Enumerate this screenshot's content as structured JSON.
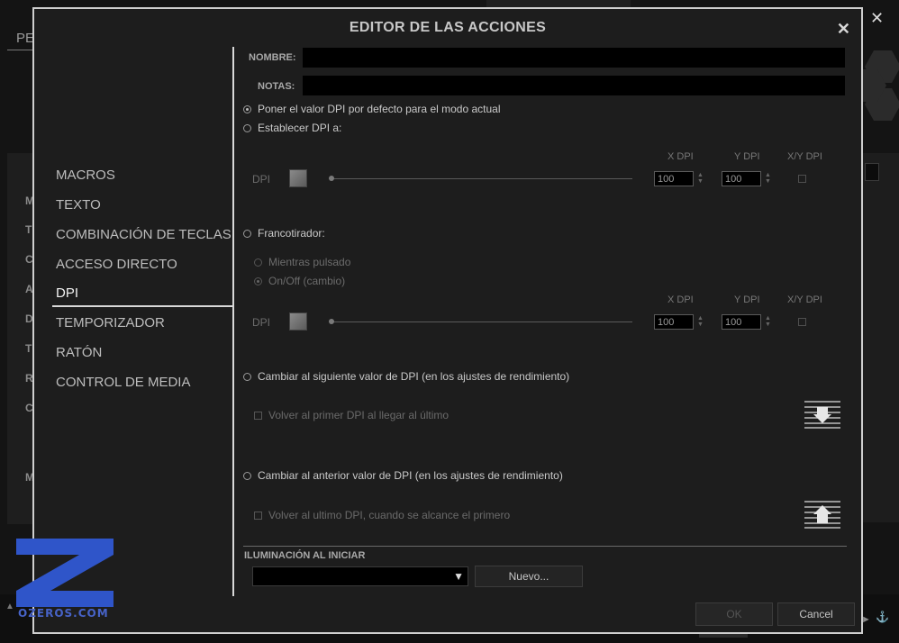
{
  "background_app": {
    "top_text": "PE",
    "side_letters": [
      "M",
      "T",
      "C",
      "A",
      "D",
      "T",
      "R",
      "C",
      "M"
    ]
  },
  "dialog": {
    "title": "EDITOR DE LAS ACCIONES",
    "close_glyph": "✕"
  },
  "nav": {
    "items": [
      "MACROS",
      "TEXTO",
      "COMBINACIÓN DE TECLAS",
      "ACCESO DIRECTO",
      "DPI",
      "TEMPORIZADOR",
      "RATÓN",
      "CONTROL DE MEDIA"
    ],
    "active": "DPI"
  },
  "form": {
    "name_label": "NOMBRE:",
    "name_value": "",
    "notes_label": "NOTAS:",
    "notes_value": ""
  },
  "dpi": {
    "option_default": "Poner el valor DPI por defecto para el modo actual",
    "option_set": "Establecer DPI a:",
    "set_row": {
      "dpi_label": "DPI",
      "x_head": "X DPI",
      "y_head": "Y DPI",
      "xy_head": "X/Y DPI",
      "x_value": "100",
      "y_value": "100"
    },
    "sniper_label": "Francotirador:",
    "sniper_hold": "Mientras pulsado",
    "sniper_toggle": "On/Off (cambio)",
    "sniper_row": {
      "dpi_label": "DPI",
      "x_head": "X DPI",
      "y_head": "Y DPI",
      "xy_head": "X/Y DPI",
      "x_value": "100",
      "y_value": "100"
    },
    "next_label": "Cambiar al siguiente valor de DPI (en los ajustes de rendimiento)",
    "next_check": "Volver al primer DPI al llegar al último",
    "prev_label": "Cambiar al anterior valor de DPI (en los ajustes de rendimiento)",
    "prev_check": "Volver al ultimo DPI, cuando se alcance el primero"
  },
  "lighting": {
    "title": "ILUMINACIÓN AL INICIAR",
    "select_value": "",
    "new_button": "Nuevo..."
  },
  "footer": {
    "ok": "OK",
    "cancel": "Cancel"
  },
  "watermark": {
    "text": "OZEROS.COM"
  },
  "colors": {
    "dialog_bg": "#1d1d1d",
    "border": "#cfcfcf",
    "watermark_blue": "#2f55c9"
  }
}
